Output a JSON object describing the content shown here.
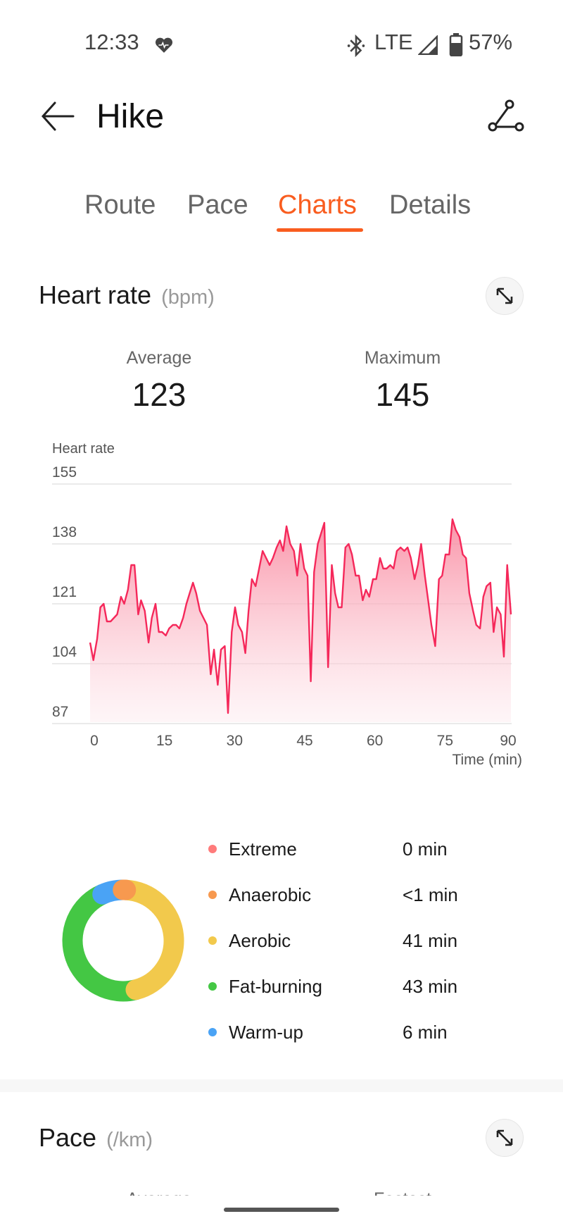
{
  "status_bar": {
    "time": "12:33",
    "network": "LTE",
    "battery": "57%",
    "icons": [
      "heart-monitor-icon",
      "bluetooth-icon",
      "signal-icon",
      "battery-icon"
    ]
  },
  "header": {
    "title": "Hike",
    "back_icon": "arrow-left-icon",
    "route_icon": "route-share-icon"
  },
  "tabs": [
    {
      "label": "Route"
    },
    {
      "label": "Pace"
    },
    {
      "label": "Charts",
      "active": true
    },
    {
      "label": "Details"
    }
  ],
  "accent_color": "#f95d1f",
  "heart_rate": {
    "title": "Heart rate",
    "unit": "(bpm)",
    "average_label": "Average",
    "average_value": "123",
    "maximum_label": "Maximum",
    "maximum_value": "145"
  },
  "chart_data": {
    "type": "area",
    "title": "Heart rate",
    "xlabel": "Time (min)",
    "ylabel": "Heart rate",
    "xlim": [
      0,
      90
    ],
    "ylim": [
      87,
      155
    ],
    "x_ticks": [
      "0",
      "15",
      "30",
      "45",
      "60",
      "75",
      "90"
    ],
    "y_ticks": [
      "155",
      "138",
      "121",
      "104",
      "87"
    ],
    "grid": true,
    "line_color": "#f5285a",
    "series": [
      {
        "x": [
          0,
          0.7,
          1.5,
          2.2,
          2.9,
          3.6,
          4.4,
          5.8,
          6.6,
          7.3,
          8.1,
          8.8,
          9.5,
          10.3,
          10.9,
          11.7,
          12.5,
          13.2,
          14,
          14.7,
          15.4,
          16.2,
          16.9,
          17.7,
          18.4,
          19.1,
          19.9,
          20.6,
          21.3,
          22,
          22.7,
          23.5,
          25,
          25.8,
          26.5,
          27.3,
          28,
          28.8,
          29.5,
          30.3,
          31,
          31.7,
          32.5,
          33.2,
          33.9,
          34.6,
          35.4,
          36.9,
          38.4,
          39.1,
          39.9,
          40.6,
          41.3,
          42,
          42.8,
          43.6,
          44.3,
          45,
          45.8,
          46.5,
          47.2,
          47.9,
          48.7,
          50.1,
          50.9,
          51.7,
          52.4,
          53.1,
          53.8,
          54.6,
          55.3,
          56,
          56.8,
          57.5,
          58.3,
          59,
          59.7,
          60.5,
          61.2,
          62,
          62.7,
          63.4,
          64.2,
          64.9,
          65.6,
          66.4,
          67.2,
          67.9,
          68.6,
          69.4,
          70.1,
          70.8,
          71.6,
          72.3,
          73,
          73.8,
          74.6,
          75.3,
          76,
          76.8,
          77.5,
          78.2,
          79,
          79.7,
          80.4,
          81.1,
          81.9,
          82.6,
          83.4,
          84.1,
          84.8,
          85.6,
          86.3,
          87,
          87.8,
          88.5,
          89.2,
          90
        ],
        "y": [
          110,
          105,
          111,
          120,
          121,
          116,
          116,
          118,
          123,
          121,
          125,
          132,
          132,
          118,
          122,
          119,
          110,
          117,
          121,
          113,
          113,
          112,
          114,
          115,
          115,
          114,
          117,
          121,
          124,
          127,
          124,
          119,
          115,
          101,
          108,
          98,
          108,
          109,
          90,
          113,
          120,
          115,
          113,
          107,
          119,
          128,
          126,
          136,
          132,
          134,
          137,
          139,
          136,
          143,
          138,
          136,
          129,
          138,
          131,
          129,
          99,
          130,
          138,
          144,
          103,
          132,
          124,
          120,
          120,
          137,
          138,
          135,
          129,
          129,
          122,
          125,
          123,
          128,
          128,
          134,
          131,
          131,
          132,
          131,
          136,
          137,
          136,
          137,
          134,
          128,
          132,
          138,
          129,
          122,
          115,
          109,
          128,
          129,
          135,
          135,
          145,
          142,
          140,
          135,
          134,
          124,
          119,
          115,
          114,
          123,
          126,
          127,
          113,
          120,
          118,
          106,
          132,
          118
        ]
      }
    ]
  },
  "zones": {
    "items": [
      {
        "name": "Extreme",
        "value": "0 min",
        "minutes": 0,
        "color": "#ff7b7b"
      },
      {
        "name": "Anaerobic",
        "value": "<1 min",
        "minutes": 0.8,
        "color": "#f7994f"
      },
      {
        "name": "Aerobic",
        "value": "41 min",
        "minutes": 41,
        "color": "#f2c94c"
      },
      {
        "name": "Fat-burning",
        "value": "43 min",
        "minutes": 43,
        "color": "#44c744"
      },
      {
        "name": "Warm-up",
        "value": "6 min",
        "minutes": 6,
        "color": "#4aa3f5"
      }
    ]
  },
  "pace": {
    "title": "Pace",
    "unit": "(/km)",
    "average_label": "Average",
    "fastest_label": "Fastest"
  }
}
